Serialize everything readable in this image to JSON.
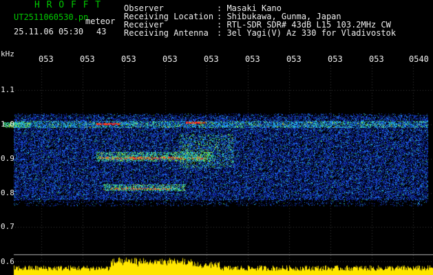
{
  "header": {
    "logo": "H R O F F T",
    "filename": "UT2511060530.pn",
    "sublabel": "meteor",
    "datetime": "25.11.06 05:30",
    "count": "43",
    "info_labels": [
      "Observer",
      "Receiving Location",
      "Receiver",
      "Receiving Antenna"
    ],
    "info_values": [
      ": Masaki Kano",
      ": Shibukawa, Gunma, Japan",
      ": RTL-SDR SDR# 43dB L15 103.2MHz CW",
      ": 3el Yagi(V) Az 330 for Vladivostok"
    ]
  },
  "axis": {
    "unit": "kHz",
    "y_ticks": [
      "1.1",
      "1.0",
      "0.9",
      "0.8",
      "0.7",
      "0.6"
    ],
    "time_ticks": [
      "053",
      "053",
      "053",
      "053",
      "053",
      "053",
      "053",
      "053",
      "053",
      "0540"
    ]
  },
  "colors": {
    "logo": "#00c800",
    "text": "#f0f0f0",
    "echo_bar": "#ffe600",
    "noise_low": "#0a1a8c",
    "noise_mid": "#1e64ff",
    "signal_hot": "#ff2020"
  }
}
